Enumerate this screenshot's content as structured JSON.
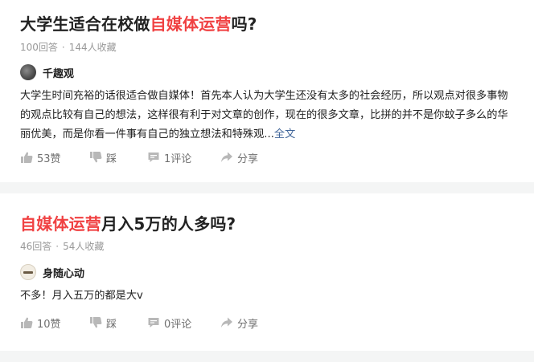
{
  "questions": [
    {
      "title_pre": "大学生适合在校做",
      "title_hl": "自媒体运营",
      "title_post": "吗?",
      "answers_count": "100回答",
      "collect_count": "144人收藏",
      "author_name": "千趣观",
      "answer_text": "大学生时间充裕的话很适合做自媒体！首先本人认为大学生还没有太多的社会经历，所以观点对很多事物的观点比较有自己的想法，这样很有利于对文章的创作，现在的很多文章，比拼的并不是你蚊子多么的华丽优美，而是你看一件事有自己的独立想法和特殊观...",
      "more_label": "全文",
      "likes": "53赞",
      "dislike_label": "踩",
      "comments": "1评论",
      "share_label": "分享"
    },
    {
      "title_pre": "",
      "title_hl": "自媒体运营",
      "title_post": "月入5万的人多吗?",
      "answers_count": "46回答",
      "collect_count": "54人收藏",
      "author_name": "身随心动",
      "answer_text": "不多！月入五万的都是大v",
      "more_label": "",
      "likes": "10赞",
      "dislike_label": "踩",
      "comments": "0评论",
      "share_label": "分享"
    }
  ],
  "colors": {
    "highlight": "#f04142",
    "link": "#406599",
    "muted": "#999999",
    "text": "#222222"
  },
  "icons": [
    "thumb-up-icon",
    "thumb-down-icon",
    "comment-icon",
    "share-icon"
  ]
}
